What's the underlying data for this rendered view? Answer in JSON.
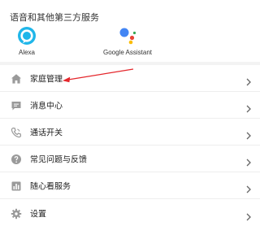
{
  "services": {
    "title": "语音和其他第三方服务",
    "items": [
      {
        "label": "Alexa",
        "icon": "alexa-icon"
      },
      {
        "label": "Google Assistant",
        "icon": "google-assistant-icon"
      }
    ]
  },
  "menu": {
    "items": [
      {
        "label": "家庭管理",
        "icon": "home-icon"
      },
      {
        "label": "消息中心",
        "icon": "message-icon"
      },
      {
        "label": "通话开关",
        "icon": "phone-icon"
      },
      {
        "label": "常见问题与反馈",
        "icon": "help-icon"
      },
      {
        "label": "随心看服务",
        "icon": "chart-icon"
      },
      {
        "label": "设置",
        "icon": "gear-icon"
      }
    ]
  },
  "colors": {
    "icon_gray": "#9a9a9a",
    "alexa_blue": "#1fb6e9",
    "arrow_red": "#e4262b",
    "google_blue": "#4285f4",
    "google_red": "#ea4335",
    "google_yellow": "#fbbc05",
    "google_green": "#34a853"
  }
}
